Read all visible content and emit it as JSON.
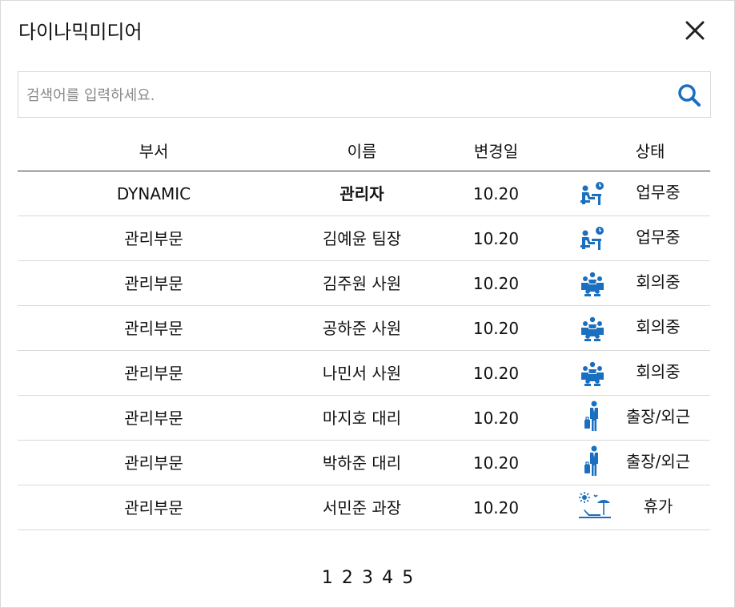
{
  "dialog": {
    "title": "다이나믹미디어",
    "close_icon": "close-icon"
  },
  "search": {
    "placeholder": "검색어를 입력하세요.",
    "value": "",
    "icon": "search-icon"
  },
  "table": {
    "headers": [
      "부서",
      "이름",
      "변경일",
      "상태"
    ],
    "rows": [
      {
        "department": "DYNAMIC",
        "name": "관리자",
        "date": "10.20",
        "status": "업무중",
        "icon": "desk-worker-icon"
      },
      {
        "department": "관리부문",
        "name": "김예윤 팀장",
        "date": "10.20",
        "status": "업무중",
        "icon": "desk-worker-icon"
      },
      {
        "department": "관리부문",
        "name": "김주원 사원",
        "date": "10.20",
        "status": "회의중",
        "icon": "meeting-icon"
      },
      {
        "department": "관리부문",
        "name": "공하준 사원",
        "date": "10.20",
        "status": "회의중",
        "icon": "meeting-icon"
      },
      {
        "department": "관리부문",
        "name": "나민서 사원",
        "date": "10.20",
        "status": "회의중",
        "icon": "meeting-icon"
      },
      {
        "department": "관리부문",
        "name": "마지호 대리",
        "date": "10.20",
        "status": "출장/외근",
        "icon": "business-trip-icon"
      },
      {
        "department": "관리부문",
        "name": "박하준 대리",
        "date": "10.20",
        "status": "출장/외근",
        "icon": "business-trip-icon"
      },
      {
        "department": "관리부문",
        "name": "서민준 과장",
        "date": "10.20",
        "status": "휴가",
        "icon": "vacation-icon"
      }
    ]
  },
  "pagination": {
    "pages": [
      "1",
      "2",
      "3",
      "4",
      "5"
    ]
  },
  "colors": {
    "icon_blue": "#1b6fbf",
    "border": "#d9d9d9",
    "header_line": "#333333"
  }
}
